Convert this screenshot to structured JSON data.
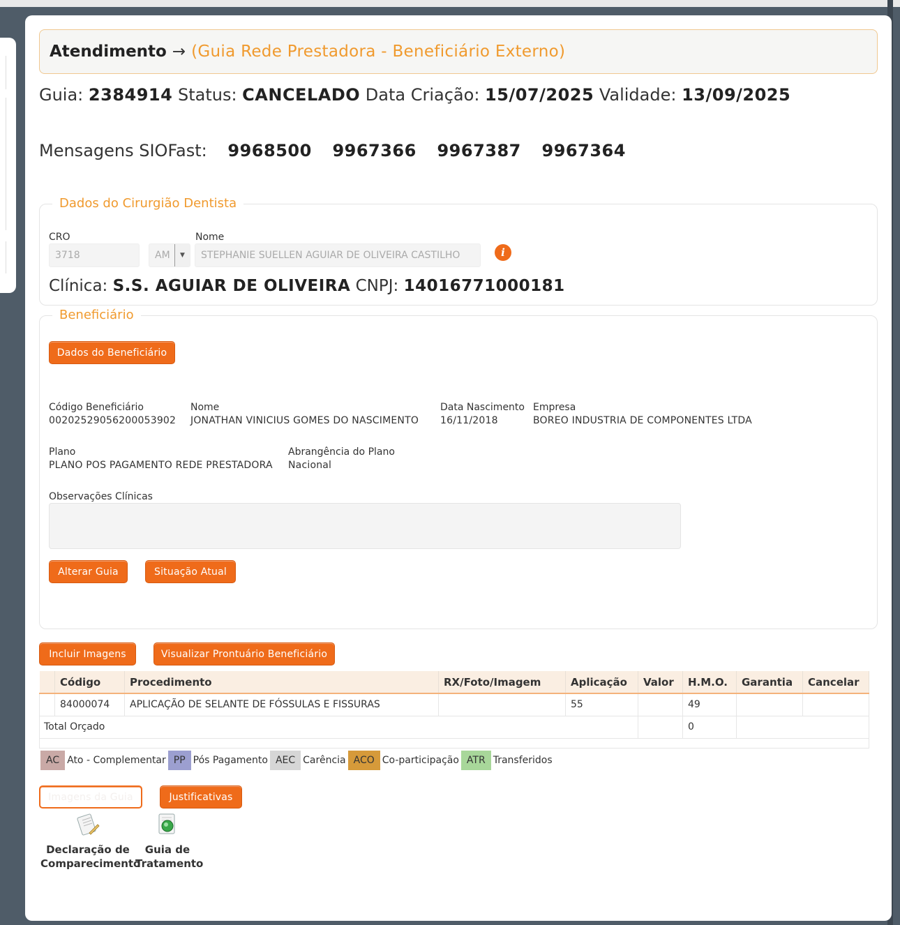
{
  "header": {
    "title": "Atendimento",
    "arrow": "→",
    "subtitle": "(Guia Rede Prestadora - Beneficiário Externo)"
  },
  "guia": {
    "guia_label": "Guia:",
    "guia_value": "2384914",
    "status_label": "Status:",
    "status_value": "CANCELADO",
    "criacao_label": "Data Criação:",
    "criacao_value": "15/07/2025",
    "validade_label": "Validade:",
    "validade_value": "13/09/2025"
  },
  "mensagens": {
    "label": "Mensagens SIOFast:",
    "items": [
      "9968500",
      "9967366",
      "9967387",
      "9967364"
    ]
  },
  "dentista": {
    "legend": "Dados do Cirurgião Dentista",
    "cro_label": "CRO",
    "cro_value": "3718",
    "uf_value": "AM",
    "nome_label": "Nome",
    "nome_value": "STEPHANIE SUELLEN AGUIAR DE OLIVEIRA CASTILHO",
    "info_icon": "i",
    "clinica_label": "Clínica:",
    "clinica_value": "S.S. AGUIAR DE OLIVEIRA",
    "cnpj_label": "CNPJ:",
    "cnpj_value": "14016771000181"
  },
  "beneficiario": {
    "legend": "Beneficiário",
    "dados_button": "Dados do Beneficiário",
    "codigo_label": "Código Beneficiário",
    "codigo_value": "00202529056200053902",
    "nome_label": "Nome",
    "nome_value": "JONATHAN VINICIUS GOMES DO NASCIMENTO",
    "nasc_label": "Data Nascimento",
    "nasc_value": "16/11/2018",
    "empresa_label": "Empresa",
    "empresa_value": "BOREO INDUSTRIA DE COMPONENTES LTDA",
    "plano_label": "Plano",
    "plano_value": "PLANO POS PAGAMENTO REDE PRESTADORA",
    "abrang_label": "Abrangência do Plano",
    "abrang_value": "Nacional",
    "obs_label": "Observações Clínicas",
    "alterar_button": "Alterar Guia",
    "situacao_button": "Situação Atual"
  },
  "actions": {
    "incluir_imagens": "Incluir Imagens",
    "visualizar_prontuario": "Visualizar Prontuário Beneficiário",
    "imagens_guia": "Imagens da Guia",
    "justificativas": "Justificativas"
  },
  "table": {
    "headers": [
      "",
      "Código",
      "Procedimento",
      "RX/Foto/Imagem",
      "Aplicação",
      "Valor",
      "H.M.O.",
      "Garantia",
      "Cancelar"
    ],
    "rows": [
      {
        "codigo": "84000074",
        "procedimento": "APLICAÇÃO DE SELANTE DE FÓSSULAS E FISSURAS",
        "rx": "",
        "aplicacao": "55",
        "valor": "",
        "hmo": "49",
        "garantia": "",
        "cancelar": ""
      }
    ],
    "total_label": "Total Orçado",
    "total_hmo": "0"
  },
  "legend_tags": [
    {
      "code": "AC",
      "label": "Ato - Complementar",
      "color": "#c9a9a6"
    },
    {
      "code": "PP",
      "label": "Pós Pagamento",
      "color": "#9c9fd0"
    },
    {
      "code": "AEC",
      "label": "Carência",
      "color": "#d6d6d6"
    },
    {
      "code": "ACO",
      "label": "Co-participação",
      "color": "#d69a3a"
    },
    {
      "code": "ATR",
      "label": "Transferidos",
      "color": "#a8d79a"
    }
  ],
  "docs": {
    "declaracao_line1": "Declaração de",
    "declaracao_line2": "Comparecimento",
    "guia_line1": "Guia de",
    "guia_line2": "Tratamento"
  },
  "colors": {
    "accent": "#ef6b1a",
    "legend_text": "#f09a2e",
    "background": "#4f5c68"
  }
}
